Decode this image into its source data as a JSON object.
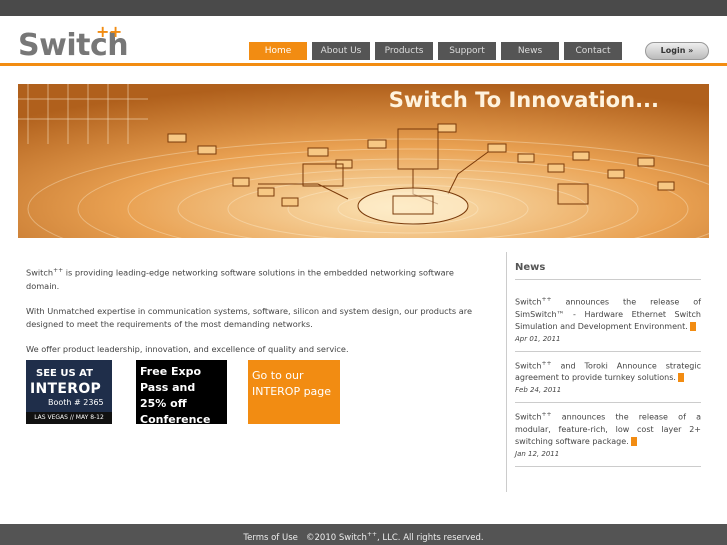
{
  "logo": {
    "text": "Switch",
    "sup": "++"
  },
  "nav": [
    {
      "label": "Home"
    },
    {
      "label": "About Us"
    },
    {
      "label": "Products"
    },
    {
      "label": "Support"
    },
    {
      "label": "News"
    },
    {
      "label": "Contact"
    }
  ],
  "login_label": "Login  »",
  "banner_title": "Switch To Innovation...",
  "intro": {
    "p1_brand": "Switch",
    "p1_sup": "++",
    "p1_rest": " is providing leading-edge networking software solutions in the embedded networking software domain.",
    "p2": "With Unmatched expertise in communication systems, software, silicon and system design, our products are designed to meet the requirements of the most demanding networks.",
    "p3": "We offer product leadership, innovation, and excellence of quality and service."
  },
  "promos": {
    "interop": {
      "line1": "SEE US AT",
      "line2": "INTEROP",
      "line3": "Booth # 2365",
      "line4": "LAS VEGAS // MAY 8-12"
    },
    "expo": "Free Expo Pass and 25% off Conference",
    "page": "Go to our INTEROP page"
  },
  "news": {
    "heading": "News",
    "items": [
      {
        "brand": "Switch",
        "sup": "++",
        "text": " announces the release of SimSwitch™ - Hardware Ethernet Switch Simulation and Development Environment.",
        "date": "Apr 01, 2011"
      },
      {
        "brand": "Switch",
        "sup": "++",
        "text": " and Toroki Announce strategic agreement to provide turnkey solutions.",
        "date": "Feb 24, 2011"
      },
      {
        "brand": "Switch",
        "sup": "++",
        "text": " announces the release of a modular, feature-rich, low cost layer 2+ switching software package.",
        "date": "Jan 12, 2011"
      }
    ]
  },
  "footer": {
    "terms": "Terms of Use",
    "copy_pre": "©2010 Switch",
    "copy_sup": "++",
    "copy_post": ", LLC.   All rights reserved."
  },
  "colors": {
    "accent": "#f28c12",
    "nav_bg": "#555555",
    "footer_bg": "#545454"
  }
}
